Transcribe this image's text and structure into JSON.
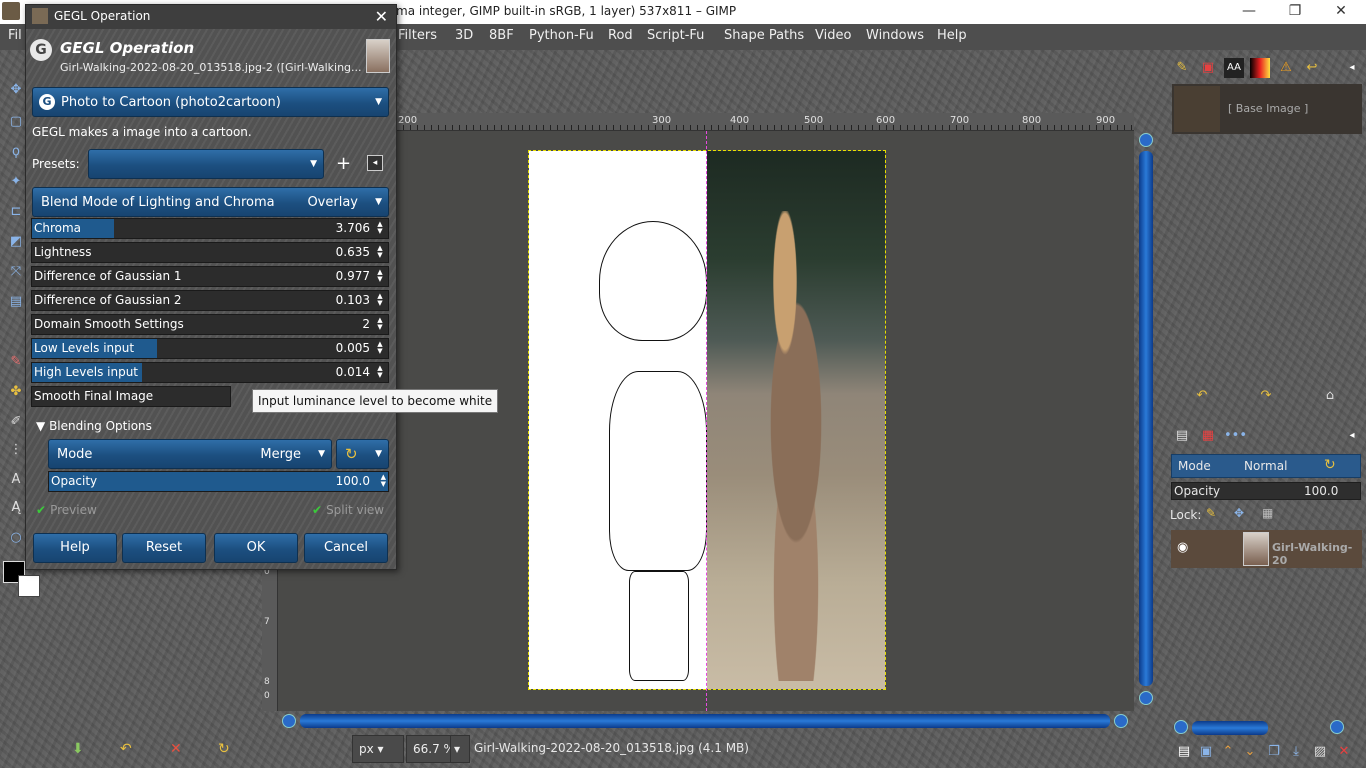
{
  "window": {
    "title": "ma integer, GIMP built-in sRGB, 1 layer) 537x811 – GIMP",
    "minimize": "—",
    "maximize": "❐",
    "close": "✕"
  },
  "menu": {
    "items": [
      "Fil",
      "Filters",
      "3D",
      "8BF",
      "Python-Fu",
      "Rod",
      "Script-Fu",
      "Shape Paths",
      "Video",
      "Windows",
      "Help"
    ]
  },
  "ruler": {
    "h_ticks": [
      "200",
      "300",
      "400",
      "500",
      "600",
      "700",
      "800",
      "900"
    ],
    "v_ticks": [
      "0",
      "7",
      "8",
      "0"
    ]
  },
  "statusbar": {
    "unit": "px",
    "zoom": "66.7 %",
    "file_info": "Girl-Walking-2022-08-20_013518.jpg (4.1 MB)"
  },
  "right_dock": {
    "base_image_label": "[ Base Image ]",
    "layer_mode_label": "Mode",
    "layer_mode_value": "Normal",
    "layer_opacity_label": "Opacity",
    "layer_opacity_value": "100.0",
    "lock_label": "Lock:",
    "layer_name": "Girl-Walking-20"
  },
  "gegl": {
    "dialog_title": "GEGL Operation",
    "close": "✕",
    "header_title": "GEGL Operation",
    "header_subtitle": "Girl-Walking-2022-08-20_013518.jpg-2 ([Girl-Walking...",
    "operation": "Photo to Cartoon (photo2cartoon)",
    "description": "GEGL makes a image into a cartoon.",
    "presets_label": "Presets:",
    "blend_label": "Blend Mode of Lighting and Chroma",
    "blend_value": "Overlay",
    "sliders": [
      {
        "label": "Chroma",
        "value": "3.706",
        "fill": 0.23
      },
      {
        "label": "Lightness",
        "value": "0.635",
        "fill": 0.0
      },
      {
        "label": "Difference of Gaussian 1",
        "value": "0.977",
        "fill": 0.0
      },
      {
        "label": "Difference of Gaussian 2",
        "value": "0.103",
        "fill": 0.0
      },
      {
        "label": "Domain Smooth Settings",
        "value": "2",
        "fill": 0.0
      },
      {
        "label": "Low Levels input",
        "value": "0.005",
        "fill": 0.35
      },
      {
        "label": "High Levels input",
        "value": "0.014",
        "fill": 0.31
      },
      {
        "label": "Smooth Final Image",
        "value": "",
        "fill": 0.0
      }
    ],
    "tooltip": "Input luminance level to become white",
    "blending_options": "Blending Options",
    "mode_label": "Mode",
    "mode_value": "Merge",
    "opacity_label": "Opacity",
    "opacity_value": "100.0",
    "preview_label": "Preview",
    "split_view_label": "Split view",
    "buttons": {
      "help": "Help",
      "reset": "Reset",
      "ok": "OK",
      "cancel": "Cancel"
    }
  }
}
